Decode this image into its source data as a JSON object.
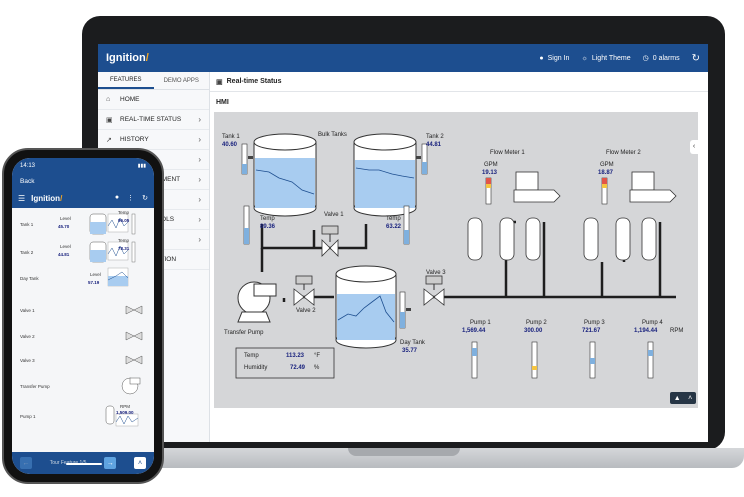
{
  "app": {
    "brand": "Ignition",
    "sign_in": "Sign In",
    "theme": "Light Theme",
    "alarms": "0 alarms"
  },
  "sidebar": {
    "tabs": [
      "FEATURES",
      "DEMO APPS"
    ],
    "items": [
      {
        "label": "HOME",
        "icon": "home-icon"
      },
      {
        "label": "REAL-TIME STATUS",
        "icon": "monitor-icon"
      },
      {
        "label": "HISTORY",
        "icon": "chart-line-icon"
      },
      {
        "label": "",
        "icon": ""
      },
      {
        "label": "AGEMENT",
        "icon": ""
      },
      {
        "label": "",
        "icon": ""
      },
      {
        "label": "OOLS",
        "icon": ""
      },
      {
        "label": "",
        "icon": ""
      },
      {
        "label": "NITION",
        "icon": ""
      }
    ]
  },
  "main": {
    "title": "Real-time Status",
    "section": "HMI"
  },
  "hmi": {
    "tank1": {
      "label": "Tank 1",
      "value": "40.60"
    },
    "tank2": {
      "label": "Tank 2",
      "value": "44.81"
    },
    "bulk_tanks": "Bulk Tanks",
    "temp1": {
      "label": "Temp",
      "value": "89.36"
    },
    "temp2": {
      "label": "Temp",
      "value": "63.22"
    },
    "valve1": "Valve 1",
    "valve2": "Valve 2",
    "valve3": "Valve 3",
    "transfer_pump": "Transfer Pump",
    "day_tank": {
      "label": "Day Tank",
      "value": "35.77"
    },
    "flow1": {
      "label": "Flow Meter 1",
      "unit": "GPM",
      "value": "19.13"
    },
    "flow2": {
      "label": "Flow Meter 2",
      "unit": "GPM",
      "value": "18.87"
    },
    "pumps": [
      {
        "label": "Pump 1",
        "value": "1,569.44"
      },
      {
        "label": "Pump 2",
        "value": "300.00"
      },
      {
        "label": "Pump 3",
        "value": "721.67"
      },
      {
        "label": "Pump 4",
        "value": "1,194.44"
      }
    ],
    "rpm": "RPM",
    "env": {
      "temp_label": "Temp",
      "temp_value": "113.23",
      "temp_unit": "°F",
      "humidity_label": "Humidity",
      "humidity_value": "72.49",
      "humidity_unit": "%"
    }
  },
  "phone": {
    "time": "14:13",
    "back": "Back",
    "brand": "Ignition",
    "rows": [
      {
        "label": "Tank 1",
        "level_label": "Level",
        "level": "45.70",
        "temp_label": "Temp",
        "temp": "96.05"
      },
      {
        "label": "Tank 2",
        "level_label": "Level",
        "level": "44.81",
        "temp_label": "Temp",
        "temp": "78.31"
      },
      {
        "label": "Day Tank",
        "level_label": "Level",
        "level": "57.19"
      },
      {
        "label": "Valve 1"
      },
      {
        "label": "Valve 2"
      },
      {
        "label": "Valve 3"
      },
      {
        "label": "Transfer Pump"
      },
      {
        "label": "Pump 1",
        "level_label": "RPM",
        "level": "1,509.00"
      }
    ],
    "tour": "Tour Feature 1/5"
  },
  "colors": {
    "header_blue": "#1d4e8f",
    "accent_orange": "#f5a623",
    "value_blue": "#1a237e",
    "tank_liquid": "#a8ccf0"
  }
}
